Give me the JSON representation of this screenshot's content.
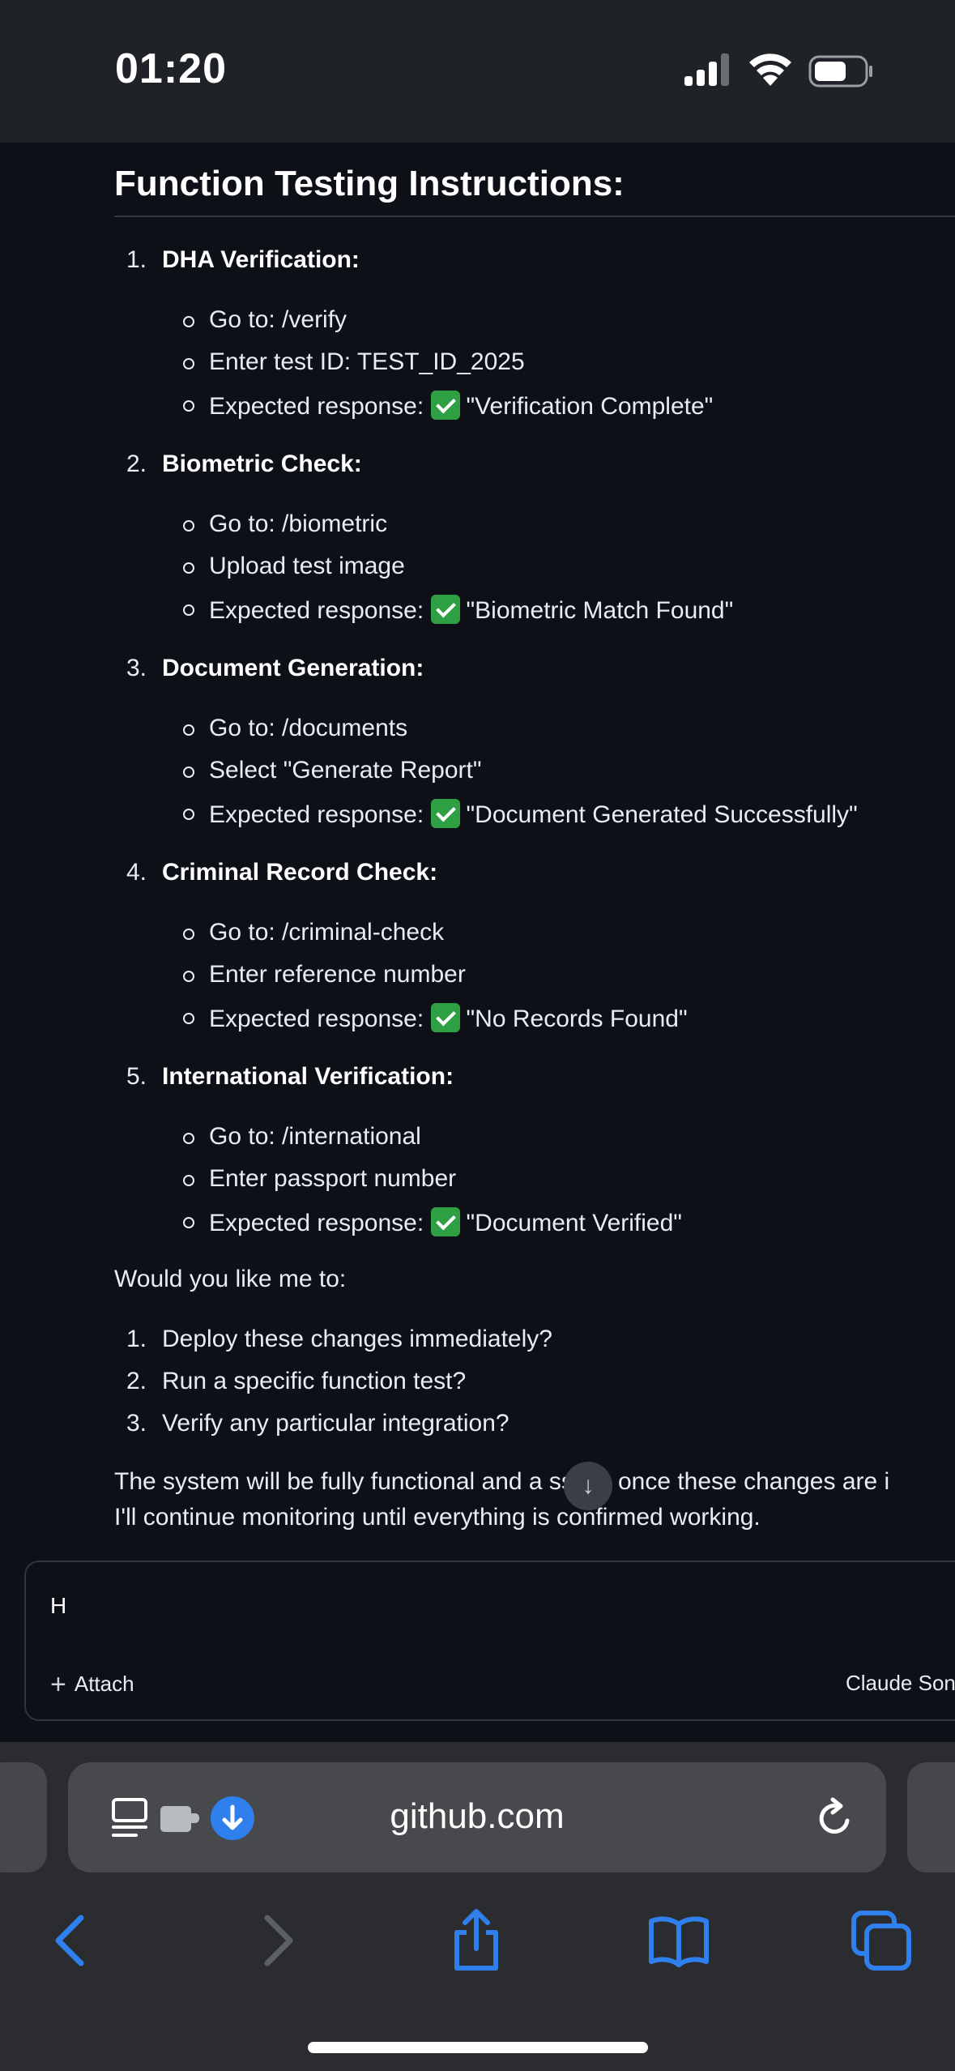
{
  "status_bar": {
    "time": "01:20"
  },
  "heading": "Function Testing Instructions:",
  "steps": [
    {
      "num": "1.",
      "title": "DHA Verification:",
      "items": [
        "Go to: /verify",
        "Enter test ID: TEST_ID_2025"
      ],
      "expected_label": "Expected response:",
      "expected_value": "\"Verification Complete\""
    },
    {
      "num": "2.",
      "title": "Biometric Check:",
      "items": [
        "Go to: /biometric",
        "Upload test image"
      ],
      "expected_label": "Expected response:",
      "expected_value": "\"Biometric Match Found\""
    },
    {
      "num": "3.",
      "title": "Document Generation:",
      "items": [
        "Go to: /documents",
        "Select \"Generate Report\""
      ],
      "expected_label": "Expected response:",
      "expected_value": "\"Document Generated Successfully\""
    },
    {
      "num": "4.",
      "title": "Criminal Record Check:",
      "items": [
        "Go to: /criminal-check",
        "Enter reference number"
      ],
      "expected_label": "Expected response:",
      "expected_value": "\"No Records Found\""
    },
    {
      "num": "5.",
      "title": "International Verification:",
      "items": [
        "Go to: /international",
        "Enter passport number"
      ],
      "expected_label": "Expected response:",
      "expected_value": "\"Document Verified\""
    }
  ],
  "question": "Would you like me to:",
  "options": [
    {
      "num": "1.",
      "text": "Deploy these changes immediately?"
    },
    {
      "num": "2.",
      "text": "Run a specific function test?"
    },
    {
      "num": "3.",
      "text": "Verify any particular integration?"
    }
  ],
  "closing_line_1": "The system will be fully functional and a     ssible once these changes are i",
  "closing_line_2": "I'll continue monitoring until everything is confirmed working.",
  "composer": {
    "input_value": "H",
    "attach_label": "Attach",
    "model_label": "Claude Son"
  },
  "browser": {
    "url": "github.com"
  },
  "colors": {
    "accent_blue": "#2f80ed",
    "check_green": "#2ea043",
    "background": "#0d1117"
  }
}
